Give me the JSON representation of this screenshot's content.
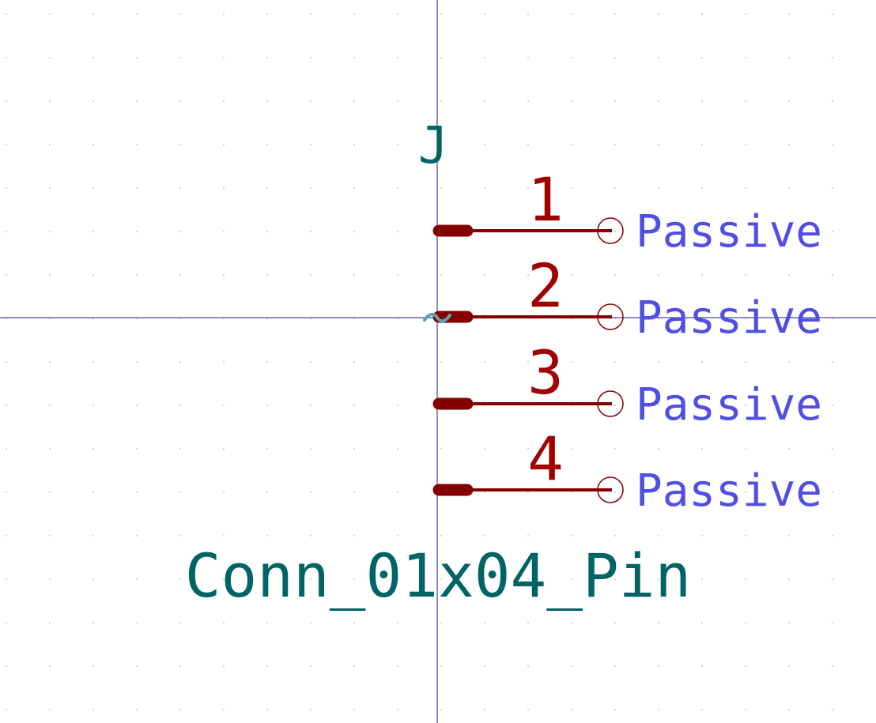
{
  "symbol": {
    "reference": "J",
    "value": "Conn_01x04_Pin"
  },
  "pins": [
    {
      "number": "1",
      "type": "Passive"
    },
    {
      "number": "2",
      "type": "Passive"
    },
    {
      "number": "3",
      "type": "Passive"
    },
    {
      "number": "4",
      "type": "Passive"
    }
  ],
  "colors": {
    "background": "#ffffff",
    "grid_dot": "#c8c8c8",
    "axis": "#1a1a8c",
    "pin": "#840000",
    "pin_number": "#a00000",
    "pin_type": "#4f4fe6",
    "field_text": "#006464",
    "anchor": "#5aa6aa"
  },
  "icons": {
    "anchor": "anchor-tilde-icon",
    "pin_end": "pin-endpoint-circle-icon"
  }
}
